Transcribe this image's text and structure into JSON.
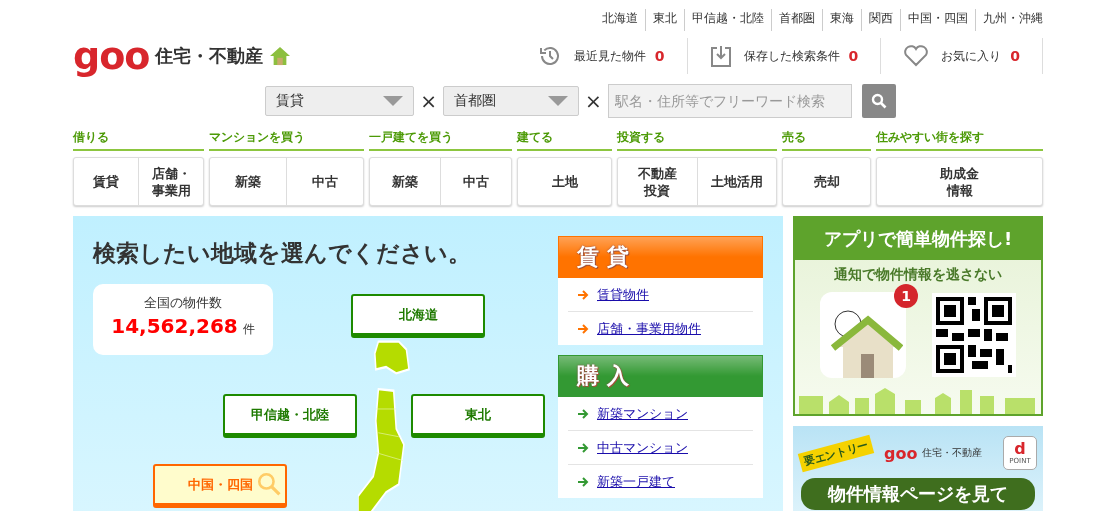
{
  "region_links": [
    "北海道",
    "東北",
    "甲信越・北陸",
    "首都圏",
    "東海",
    "関西",
    "中国・四国",
    "九州・沖縄"
  ],
  "logo": {
    "brand": "goo",
    "title": "住宅・不動産"
  },
  "header_counters": [
    {
      "kind": "history",
      "label": "最近見た物件",
      "count": "0"
    },
    {
      "kind": "saved",
      "label": "保存した検索条件",
      "count": "0"
    },
    {
      "kind": "favorite",
      "label": "お気に入り",
      "count": "0"
    }
  ],
  "search": {
    "type_select": "賃貸",
    "area_select": "首都圏",
    "separator": "×",
    "placeholder": "駅名・住所等でフリーワード検索"
  },
  "nav_groups": [
    {
      "heading": "借りる",
      "items": [
        "賃貸",
        "店舗・事業用"
      ]
    },
    {
      "heading": "マンションを買う",
      "items": [
        "新築",
        "中古"
      ]
    },
    {
      "heading": "一戸建てを買う",
      "items": [
        "新築",
        "中古"
      ]
    },
    {
      "heading": "建てる",
      "items": [
        "土地"
      ]
    },
    {
      "heading": "投資する",
      "items": [
        "不動産投資",
        "土地活用"
      ]
    },
    {
      "heading": "売る",
      "items": [
        "売却"
      ]
    },
    {
      "heading": "住みやすい街を探す",
      "items": [
        "助成金情報"
      ]
    }
  ],
  "map_panel": {
    "title": "検索したい地域を選んでください。",
    "total_label": "全国の物件数",
    "total_count": "14,562,268",
    "total_unit": "件",
    "regions": [
      {
        "label": "北海道",
        "selected": false
      },
      {
        "label": "甲信越・北陸",
        "selected": false
      },
      {
        "label": "東北",
        "selected": false
      },
      {
        "label": "中国・四国",
        "selected": true
      }
    ]
  },
  "categories": [
    {
      "title": "賃貸",
      "color": "#ff7300",
      "links": [
        "賃貸物件",
        "店舗・事業用物件"
      ]
    },
    {
      "title": "購入",
      "color": "#339933",
      "links": [
        "新築マンション",
        "中古マンション",
        "新築一戸建て"
      ]
    }
  ],
  "app_banner": {
    "headline": "アプリで簡単物件探し!",
    "subline": "通知で物件情報を逃さない",
    "badge": "1"
  },
  "point_banner": {
    "ribbon": "要エントリー",
    "brand": "goo",
    "brand_title": "住宅・不動産",
    "point_mark": "d",
    "point_label": "POINT",
    "headline": "物件情報ページを見て"
  }
}
